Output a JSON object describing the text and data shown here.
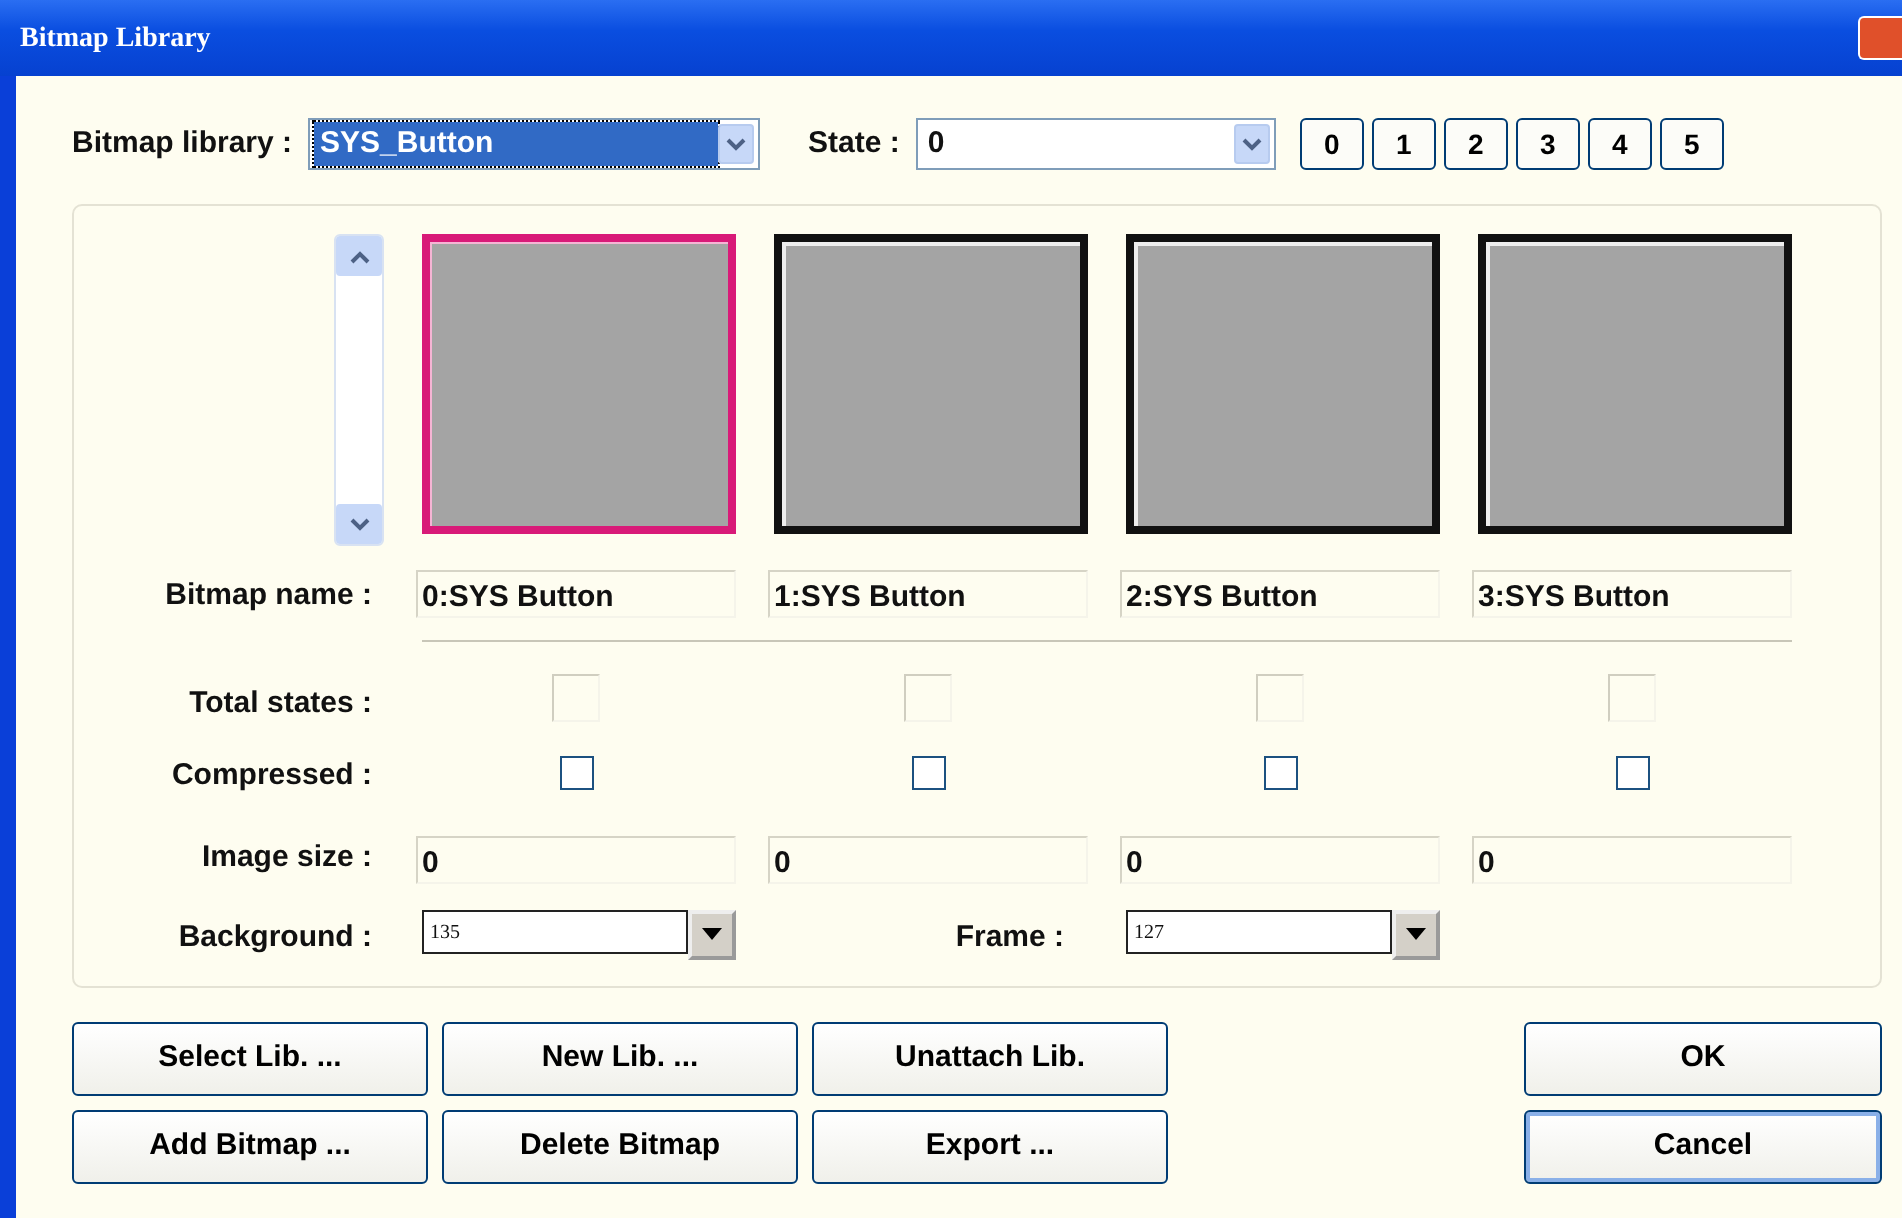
{
  "window": {
    "title": "Bitmap Library"
  },
  "library": {
    "label": "Bitmap library :",
    "value": "SYS_Button"
  },
  "state": {
    "label": "State :",
    "value": "0"
  },
  "state_buttons": [
    "0",
    "1",
    "2",
    "3",
    "4",
    "5"
  ],
  "row_labels": {
    "bitmap_name": "Bitmap name :",
    "total_states": "Total states :",
    "compressed": "Compressed :",
    "image_size": "Image size :"
  },
  "bitmaps": [
    {
      "name": "0:SYS Button",
      "selected": true,
      "compressed": false,
      "image_size": "0"
    },
    {
      "name": "1:SYS Button",
      "selected": false,
      "compressed": false,
      "image_size": "0"
    },
    {
      "name": "2:SYS Button",
      "selected": false,
      "compressed": false,
      "image_size": "0"
    },
    {
      "name": "3:SYS Button",
      "selected": false,
      "compressed": false,
      "image_size": "0"
    }
  ],
  "background": {
    "label": "Background :",
    "value": "135"
  },
  "frame": {
    "label": "Frame :",
    "value": "127"
  },
  "buttons": [
    {
      "label": "Select Lib. ..."
    },
    {
      "label": "New Lib. ..."
    },
    {
      "label": "Unattach Lib."
    },
    {
      "label": "Add Bitmap ..."
    },
    {
      "label": "Delete Bitmap"
    },
    {
      "label": "Export ..."
    }
  ],
  "dialog_buttons": [
    {
      "label": "OK",
      "focused": false
    },
    {
      "label": "Cancel",
      "focused": true
    }
  ]
}
